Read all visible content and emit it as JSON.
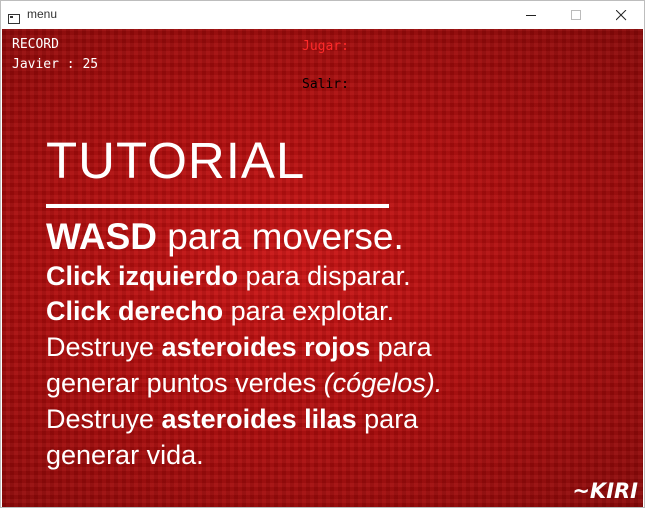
{
  "window": {
    "title": "menu",
    "controls": {
      "minimize": "minimize-icon",
      "maximize": "maximize-icon",
      "close": "close-icon"
    }
  },
  "hud": {
    "record_label": "RECORD",
    "record_entry": "Javier : 25"
  },
  "menu": {
    "items": [
      {
        "label": "Jugar:",
        "color": "#ff2a2a"
      },
      {
        "label": "Salir:",
        "color": "#000000"
      }
    ]
  },
  "tutorial": {
    "heading": "TUTORIAL",
    "line1": {
      "bold": "WASD",
      "rest": " para moverse."
    },
    "line2": {
      "bold": "Click izquierdo",
      "rest": " para disparar."
    },
    "line3": {
      "bold": "Click derecho",
      "rest": " para explotar."
    },
    "line4": {
      "pre": "Destruye ",
      "bold": "asteroides rojos",
      "rest": " para"
    },
    "line5": {
      "pre": "generar puntos verdes ",
      "italic": "(cógelos)."
    },
    "line6": {
      "pre": "Destruye ",
      "bold": "asteroides lilas",
      "rest": " para"
    },
    "line7": {
      "pre": "generar vida."
    },
    "signature": "~KIRI"
  },
  "colors": {
    "background": "#b10d0d",
    "text": "#ffffff",
    "selected_option": "#ff2a2a"
  }
}
